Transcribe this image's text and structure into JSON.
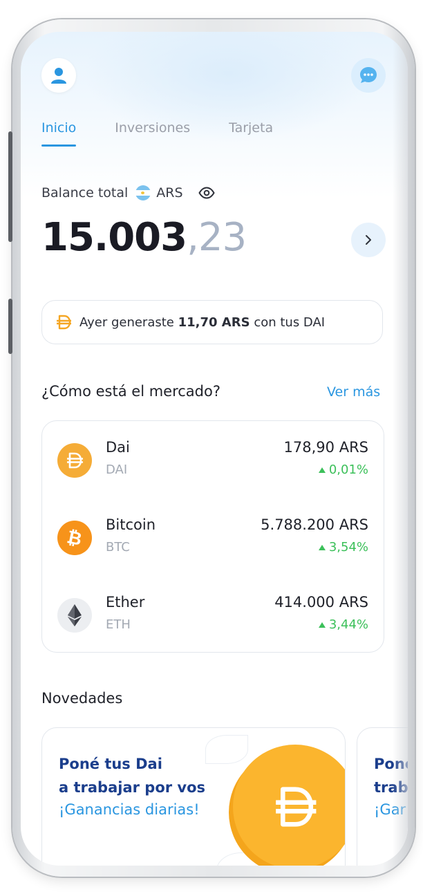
{
  "header": {
    "profile_icon": "user-icon",
    "chat_icon": "chat-bubble-icon"
  },
  "tabs": [
    {
      "label": "Inicio",
      "active": true
    },
    {
      "label": "Inversiones",
      "active": false
    },
    {
      "label": "Tarjeta",
      "active": false
    }
  ],
  "balance": {
    "label": "Balance total",
    "currency": "ARS",
    "integer": "15.003",
    "decimals": ",23"
  },
  "notice": {
    "prefix": "Ayer generaste",
    "amount": "11,70 ARS",
    "suffix": "con tus DAI"
  },
  "market": {
    "title": "¿Cómo está el mercado?",
    "see_more": "Ver más",
    "coins": [
      {
        "name": "Dai",
        "symbol": "DAI",
        "price": "178,90 ARS",
        "change": "0,01%",
        "color": "#f5ac37"
      },
      {
        "name": "Bitcoin",
        "symbol": "BTC",
        "price": "5.788.200 ARS",
        "change": "3,54%",
        "color": "#f7931a"
      },
      {
        "name": "Ether",
        "symbol": "ETH",
        "price": "414.000 ARS",
        "change": "3,44%",
        "color": "#eceef1"
      }
    ]
  },
  "news": {
    "title": "Novedades",
    "cards": [
      {
        "line1": "Poné tus Dai",
        "line2": "a trabajar por vos",
        "line3": "¡Ganancias diarias!"
      },
      {
        "line1": "Poné",
        "line2": "trab",
        "line3": "¡Gar"
      }
    ]
  },
  "colors": {
    "accent": "#2a96e0",
    "positive": "#3cc05a",
    "news_title": "#1b3e8c",
    "dai_coin": "#fbb52e"
  }
}
